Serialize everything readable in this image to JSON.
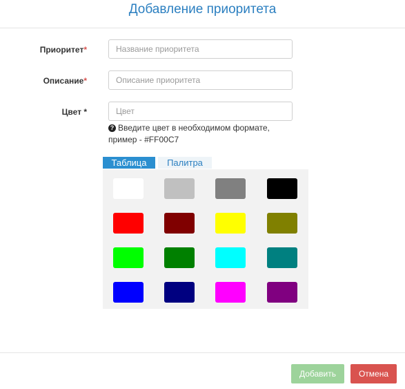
{
  "dialog": {
    "title": "Добавление приоритета"
  },
  "form": {
    "priority": {
      "label": "Приоритет",
      "required_mark": "*",
      "value": "",
      "placeholder": "Название приоритета"
    },
    "description": {
      "label": "Описание",
      "required_mark": "*",
      "value": "",
      "placeholder": "Описание приоритета"
    },
    "color": {
      "label": "Цвет *",
      "value": "",
      "placeholder": "Цвет",
      "hint_icon": "question-circle-icon",
      "hint": "Введите цвет в необходимом формате, пример - #FF00C7"
    }
  },
  "tabs": [
    {
      "label": "Таблица",
      "active": true
    },
    {
      "label": "Палитра",
      "active": false
    }
  ],
  "palette": {
    "colors": [
      "#ffffff",
      "#c0c0c0",
      "#808080",
      "#000000",
      "#ff0000",
      "#800000",
      "#ffff00",
      "#808000",
      "#00ff00",
      "#008000",
      "#00ffff",
      "#008080",
      "#0000ff",
      "#000080",
      "#ff00ff",
      "#800080"
    ]
  },
  "buttons": {
    "add": "Добавить",
    "cancel": "Отмена"
  },
  "theme": {
    "accent": "#2b8fd0",
    "add_button": "#9dd39b",
    "cancel_button": "#d9534f",
    "required": "#d9534f"
  }
}
